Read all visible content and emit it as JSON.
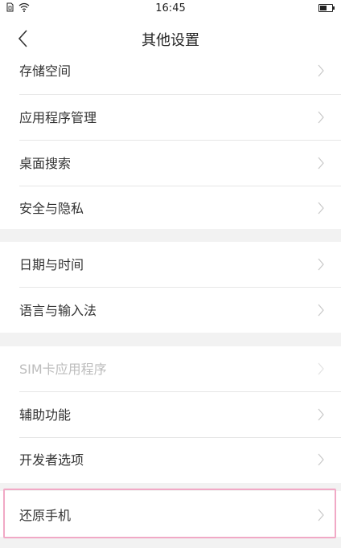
{
  "status_bar": {
    "time": "16:45",
    "battery_level": 0.6
  },
  "header": {
    "title": "其他设置"
  },
  "groups": [
    {
      "items": [
        "存储空间",
        "应用程序管理",
        "桌面搜索",
        "安全与隐私"
      ]
    },
    {
      "items": [
        "日期与时间",
        "语言与输入法"
      ]
    },
    {
      "items": [
        "SIM卡应用程序",
        "辅助功能",
        "开发者选项"
      ]
    },
    {
      "items": [
        "还原手机"
      ]
    }
  ],
  "disabled_items": [
    "SIM卡应用程序"
  ],
  "highlight_item": "还原手机",
  "colors": {
    "highlight_border": "#f1a9c6",
    "disabled_text": "#bcbcbc"
  }
}
